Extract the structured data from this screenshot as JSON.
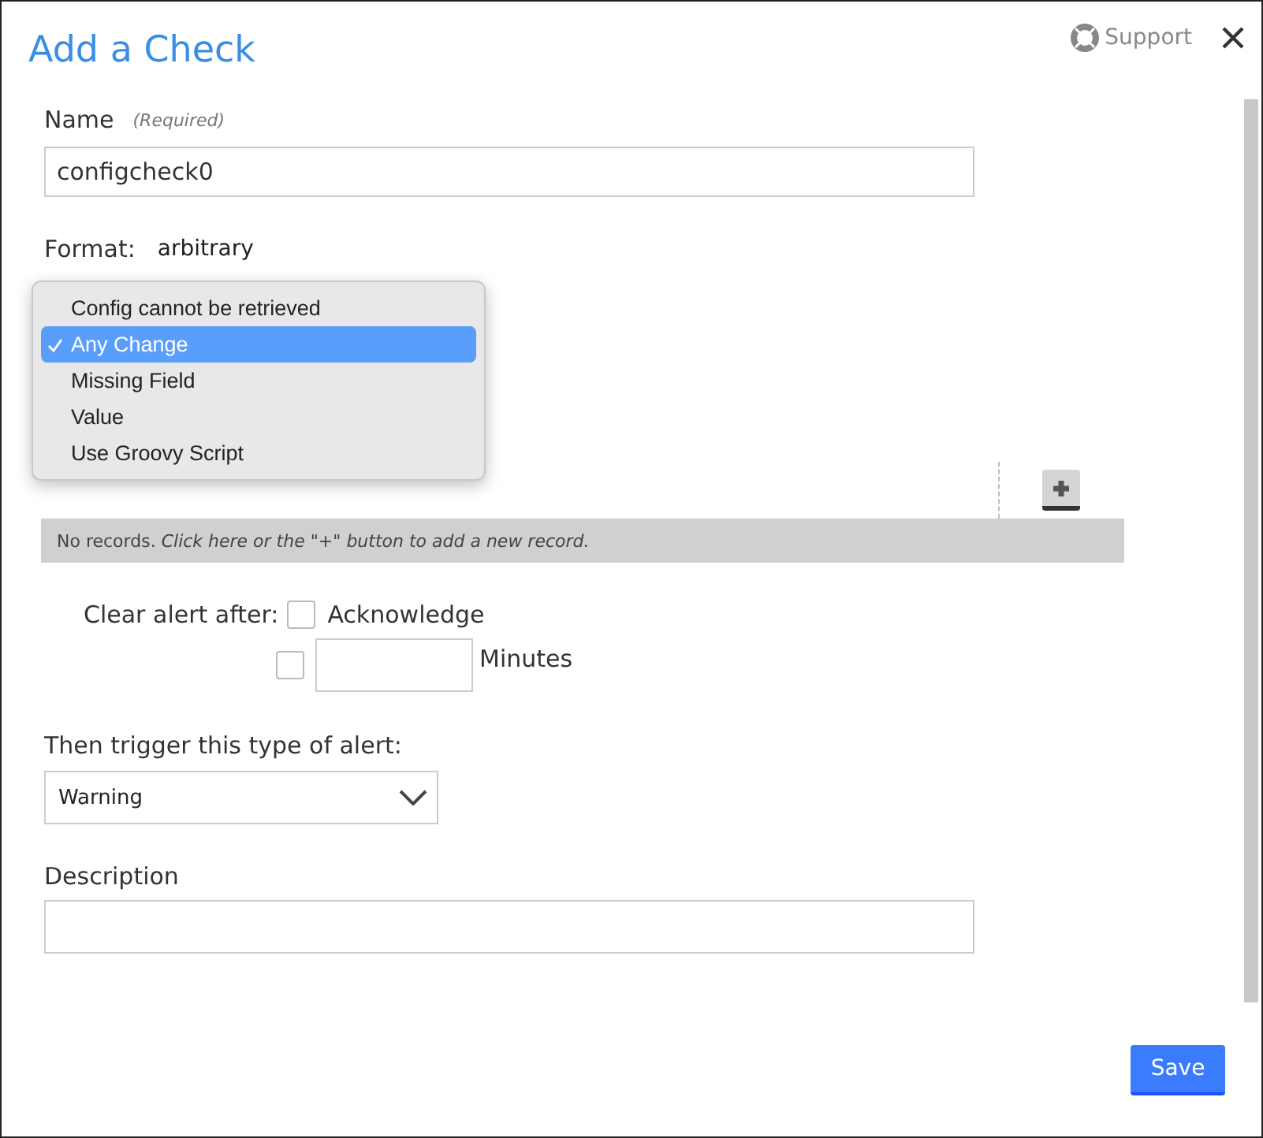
{
  "dialog": {
    "title": "Add a Check",
    "support_link": "Support"
  },
  "name_field": {
    "label": "Name",
    "hint": "(Required)",
    "value": "configcheck0"
  },
  "format": {
    "label": "Format:",
    "value": "arbitrary"
  },
  "condition_menu": {
    "options": [
      {
        "label": "Config cannot be retrieved",
        "selected": false
      },
      {
        "label": "Any Change",
        "selected": true
      },
      {
        "label": "Missing Field",
        "selected": false
      },
      {
        "label": "Value",
        "selected": false
      },
      {
        "label": "Use Groovy Script",
        "selected": false
      }
    ]
  },
  "records_table": {
    "empty_message": "No records. *Click here or the \"+\" button to add a new record.*"
  },
  "clear_alert": {
    "label": "Clear alert after:",
    "acknowledge": {
      "label": "Acknowledge",
      "checked": false
    },
    "minutes": {
      "label": "Minutes",
      "checked": false
    }
  },
  "alert_type": {
    "label": "Then trigger this type of alert:",
    "value": "Warning"
  },
  "description": {
    "label": "Description"
  },
  "buttons": [
    "Save"
  ]
}
